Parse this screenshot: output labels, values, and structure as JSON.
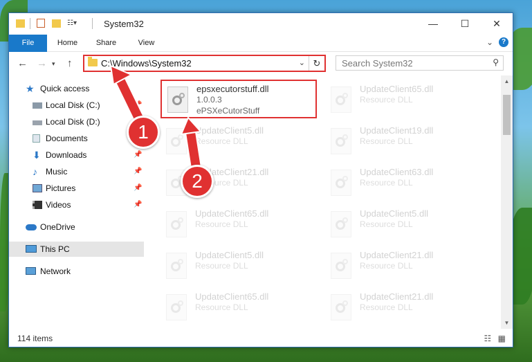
{
  "window": {
    "title": "System32"
  },
  "ribbon": {
    "tabs": [
      "File",
      "Home",
      "Share",
      "View"
    ]
  },
  "navigation": {
    "address": "C:\\Windows\\System32",
    "search_placeholder": "Search System32"
  },
  "sidebar": {
    "items": [
      {
        "label": "Quick access",
        "icon": "star-icon"
      },
      {
        "label": "Local Disk (C:)",
        "icon": "drive-icon",
        "pinned": true
      },
      {
        "label": "Local Disk (D:)",
        "icon": "drive-icon",
        "pinned": true
      },
      {
        "label": "Documents",
        "icon": "documents-icon",
        "pinned": true
      },
      {
        "label": "Downloads",
        "icon": "download-icon",
        "pinned": true
      },
      {
        "label": "Music",
        "icon": "music-icon",
        "pinned": true
      },
      {
        "label": "Pictures",
        "icon": "pictures-icon",
        "pinned": true
      },
      {
        "label": "Videos",
        "icon": "videos-icon",
        "pinned": true
      },
      {
        "label": "OneDrive",
        "icon": "cloud-icon"
      },
      {
        "label": "This PC",
        "icon": "computer-icon",
        "selected": true
      },
      {
        "label": "Network",
        "icon": "network-icon"
      }
    ]
  },
  "files": {
    "highlighted": {
      "name": "epsxecutorstuff.dll",
      "version": "1.0.0.3",
      "description": "ePSXeCutorStuff"
    },
    "col1": [
      {
        "name": "UpdateClient5.dll",
        "type": "Resource DLL"
      },
      {
        "name": "UpdateClient21.dll",
        "type": "Resource DLL"
      },
      {
        "name": "UpdateClient65.dll",
        "type": "Resource DLL"
      },
      {
        "name": "UpdateClient5.dll",
        "type": "Resource DLL"
      },
      {
        "name": "UpdateClient65.dll",
        "type": "Resource DLL"
      }
    ],
    "col2": [
      {
        "name": "UpdateClient65.dll",
        "type": "Resource DLL"
      },
      {
        "name": "UpdateClient19.dll",
        "type": "Resource DLL"
      },
      {
        "name": "UpdateClient63.dll",
        "type": "Resource DLL"
      },
      {
        "name": "UpdateClient5.dll",
        "type": "Resource DLL"
      },
      {
        "name": "UpdateClient21.dll",
        "type": "Resource DLL"
      },
      {
        "name": "UpdateClient21.dll",
        "type": "Resource DLL"
      }
    ]
  },
  "status": {
    "count": "114 items"
  },
  "callouts": [
    "1",
    "2"
  ],
  "colors": {
    "accent": "#1979ca",
    "callout": "#e03131"
  }
}
